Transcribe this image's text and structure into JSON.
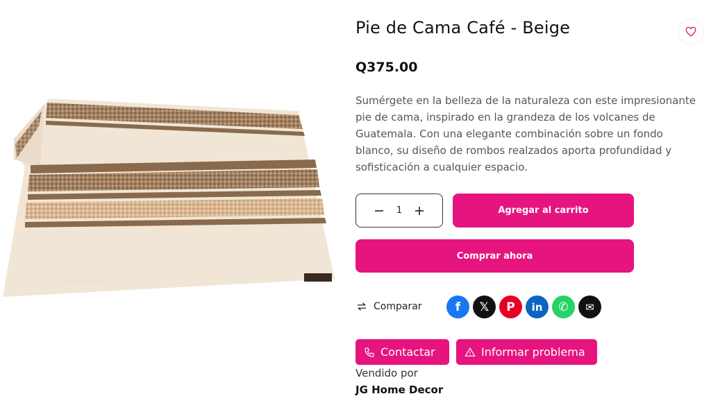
{
  "product": {
    "title": "Pie de Cama Café - Beige",
    "price": "Q375.00",
    "description": "Sumérgete en la belleza de la naturaleza con este impresionante pie de cama, inspirado en la grandeza de los volcanes de Guatemala. Con una elegante combinación sobre un fondo blanco, su diseño de rombos realzados aporta profundidad y sofisticación a cualquier espacio.",
    "image_icon": "blanket-photo"
  },
  "quantity": {
    "value": "1",
    "minus_icon": "minus-icon",
    "plus_icon": "plus-icon"
  },
  "actions": {
    "add_to_cart": "Agregar al carrito",
    "buy_now": "Comprar ahora",
    "compare": "Comparar",
    "contact": "Contactar",
    "report": "Informar problema"
  },
  "share": [
    {
      "name": "facebook",
      "glyph": "f",
      "color": "#1877f2"
    },
    {
      "name": "x",
      "glyph": "𝕏",
      "color": "#111111"
    },
    {
      "name": "pinterest",
      "glyph": "P",
      "color": "#e60023"
    },
    {
      "name": "linkedin",
      "glyph": "in",
      "color": "#0a66c2"
    },
    {
      "name": "whatsapp",
      "glyph": "✆",
      "color": "#25d366"
    },
    {
      "name": "email",
      "glyph": "✉",
      "color": "#111111"
    }
  ],
  "seller": {
    "label": "Vendido por",
    "name": "JG Home Decor"
  },
  "colors": {
    "accent": "#e6147f"
  }
}
